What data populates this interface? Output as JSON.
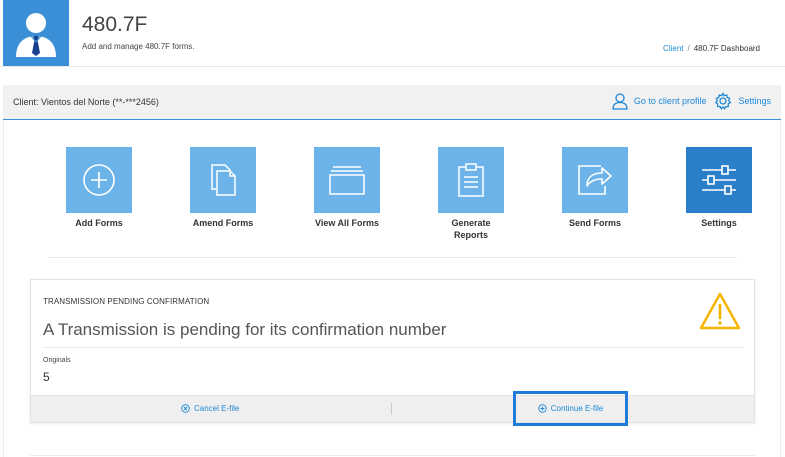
{
  "header": {
    "title": "480.7F",
    "subtitle": "Add and manage 480.7F forms.",
    "avatar_icon": "user-icon",
    "breadcrumb": {
      "link": "Client",
      "separator": "/",
      "current": "480.7F Dashboard"
    }
  },
  "client_bar": {
    "label": "Client: Vientos del Norte (**-***2456)",
    "profile_link": "Go to client profile",
    "settings_link": "Settings"
  },
  "tiles": [
    {
      "label": "Add Forms",
      "icon": "plus-circle-icon"
    },
    {
      "label": "Amend Forms",
      "icon": "documents-icon"
    },
    {
      "label": "View All Forms",
      "icon": "folder-icon"
    },
    {
      "label": "Generate Reports",
      "icon": "clipboard-icon"
    },
    {
      "label": "Send Forms",
      "icon": "share-icon"
    },
    {
      "label": "Settings",
      "icon": "sliders-icon"
    }
  ],
  "pending": {
    "caption": "TRANSMISSION PENDING CONFIRMATION",
    "title": "A Transmission is pending for its confirmation number",
    "originals_label": "Originals",
    "originals_value": "5",
    "cancel_label": "Cancel E-file",
    "continue_label": "Continue E-file",
    "warning_icon": "warning-icon"
  },
  "colors": {
    "accent": "#1e88d6",
    "tile": "#6bb3e8",
    "tile_active": "#2b7fc9",
    "warning": "#f5b400",
    "highlight": "#1f7ad8"
  }
}
